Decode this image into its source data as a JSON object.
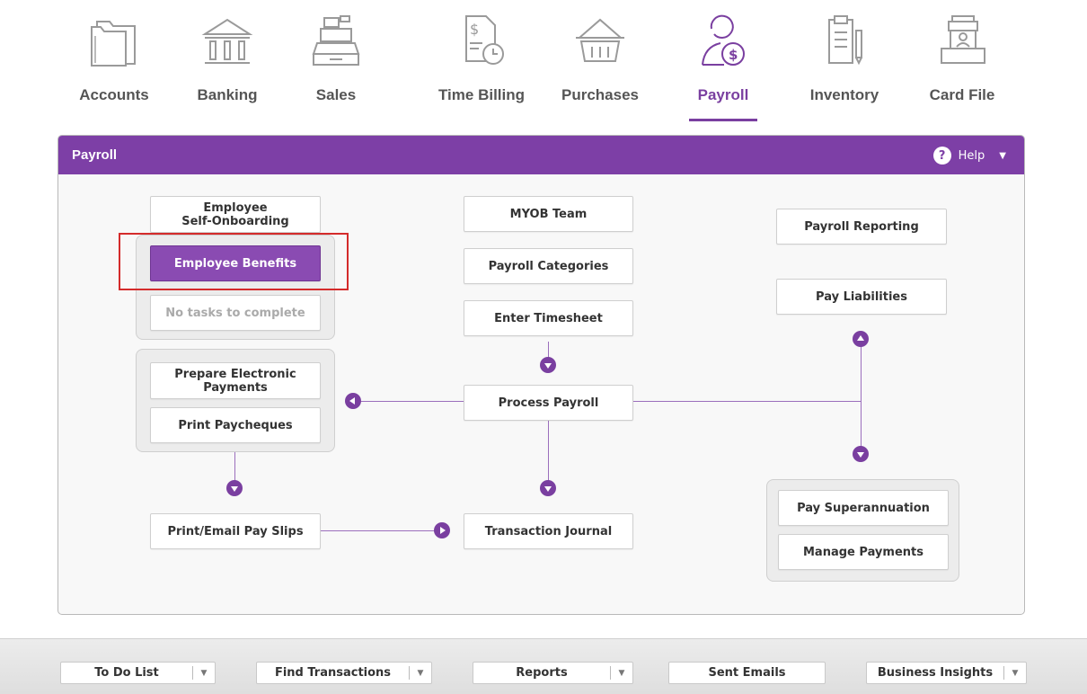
{
  "nav": {
    "items": [
      {
        "label": "Accounts",
        "icon": "accounts-folder-icon"
      },
      {
        "label": "Banking",
        "icon": "bank-icon"
      },
      {
        "label": "Sales",
        "icon": "cash-register-icon"
      },
      {
        "label": "Time Billing",
        "icon": "time-billing-icon"
      },
      {
        "label": "Purchases",
        "icon": "shopping-basket-icon"
      },
      {
        "label": "Payroll",
        "icon": "payroll-person-icon"
      },
      {
        "label": "Inventory",
        "icon": "inventory-clipboard-icon"
      },
      {
        "label": "Card File",
        "icon": "card-file-icon"
      }
    ],
    "active": "Payroll"
  },
  "panel": {
    "title": "Payroll",
    "help_label": "Help",
    "help_icon_text": "?",
    "help_caret": "▼"
  },
  "left": {
    "self_onboarding": "Employee\nSelf-Onboarding",
    "employee_benefits": "Employee Benefits",
    "no_tasks": "No tasks to complete",
    "prepare_payments": "Prepare Electronic\nPayments",
    "print_paycheques": "Print Paycheques",
    "print_email_slips": "Print/Email Pay Slips"
  },
  "center": {
    "myob_team": "MYOB Team",
    "payroll_categories": "Payroll Categories",
    "enter_timesheet": "Enter Timesheet",
    "process_payroll": "Process Payroll",
    "transaction_journal": "Transaction Journal"
  },
  "right": {
    "payroll_reporting": "Payroll Reporting",
    "pay_liabilities": "Pay Liabilities",
    "pay_superannuation": "Pay Superannuation",
    "manage_payments": "Manage Payments"
  },
  "bottom": {
    "todo": "To Do List",
    "find_transactions": "Find Transactions",
    "reports": "Reports",
    "sent_emails": "Sent Emails",
    "business_insights": "Business Insights",
    "dropdown_glyph": "▼"
  },
  "colors": {
    "accent": "#7d3fa6",
    "highlight": "#d42b2b"
  }
}
